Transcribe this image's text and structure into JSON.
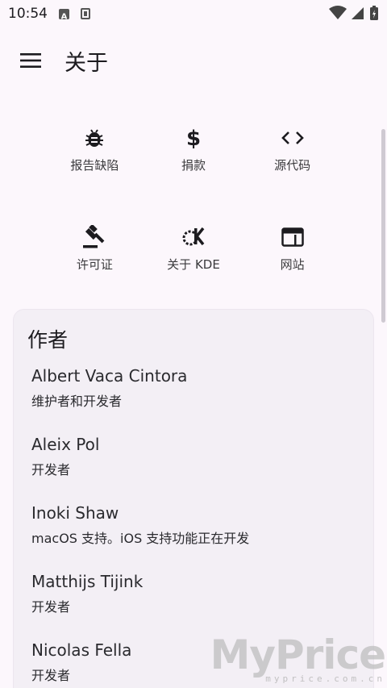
{
  "status_bar": {
    "time": "10:54"
  },
  "app_bar": {
    "title": "关于"
  },
  "actions": [
    {
      "label": "报告缺陷",
      "icon": "bug-icon"
    },
    {
      "label": "捐款",
      "icon": "dollar-icon"
    },
    {
      "label": "源代码",
      "icon": "code-icon"
    },
    {
      "label": "许可证",
      "icon": "gavel-icon"
    },
    {
      "label": "关于 KDE",
      "icon": "kde-icon"
    },
    {
      "label": "网站",
      "icon": "website-icon"
    }
  ],
  "authors": {
    "title": "作者",
    "list": [
      {
        "name": "Albert Vaca Cintora",
        "role": "维护者和开发者"
      },
      {
        "name": "Aleix Pol",
        "role": "开发者"
      },
      {
        "name": "Inoki Shaw",
        "role": "macOS 支持。iOS 支持功能正在开发"
      },
      {
        "name": "Matthijs Tijink",
        "role": "开发者"
      },
      {
        "name": "Nicolas Fella",
        "role": "开发者"
      }
    ]
  },
  "watermark": {
    "main": "MyPrice",
    "sub": "myprice.com.cn"
  }
}
